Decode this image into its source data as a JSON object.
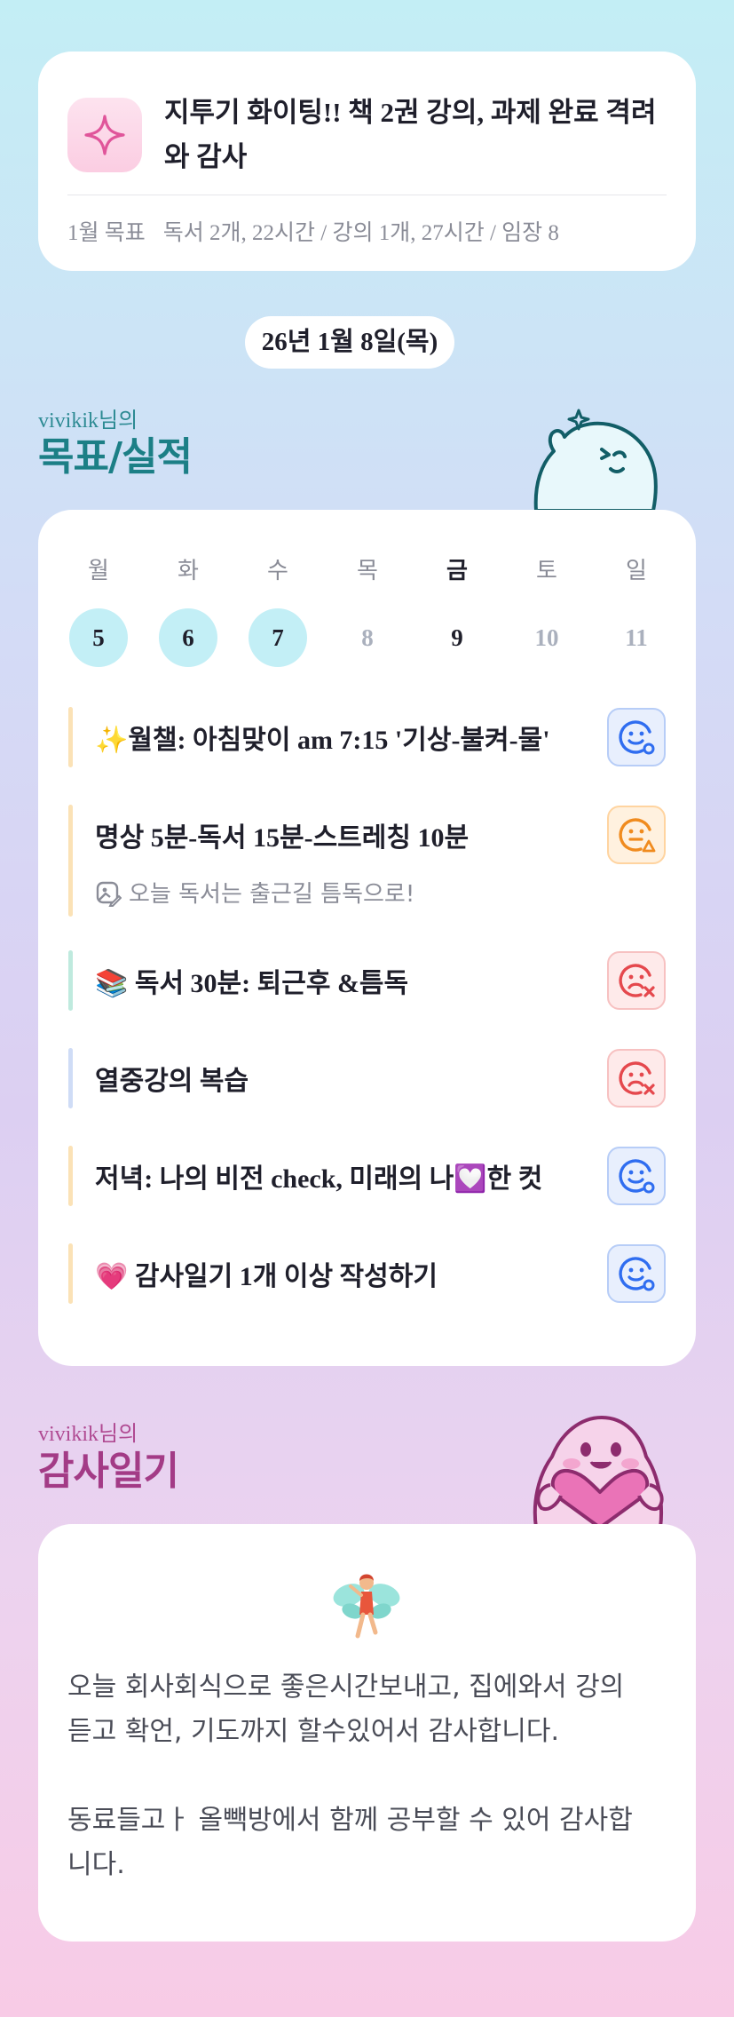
{
  "top_card": {
    "title": "지투기 화이팅!! 책 2권 강의, 과제 완료 격려와 감사",
    "goal_label": "1월 목표",
    "goal_text": "독서 2개, 22시간 / 강의 1개, 27시간 / 임장 8"
  },
  "date_pill": "26년 1월 8일(목)",
  "goals_section": {
    "user": "vivikik님의",
    "title": "목표/실적",
    "weekdays": [
      "월",
      "화",
      "수",
      "목",
      "금",
      "토",
      "일"
    ],
    "dates": [
      "5",
      "6",
      "7",
      "8",
      "9",
      "10",
      "11"
    ],
    "tasks": [
      {
        "text": "✨월챌: 아침맞이 am 7:15 '기상-불켜-물'",
        "status": "good",
        "bar": "#fbe2b6"
      },
      {
        "text": "명상 5분-독서 15분-스트레칭 10분",
        "note": "오늘 독서는 출근길 틈독으로!",
        "status": "warn",
        "bar": "#fbe2b6"
      },
      {
        "text": "📚 독서 30분: 퇴근후 &틈독",
        "status": "bad",
        "bar": "#bfeade"
      },
      {
        "text": "열중강의 복습",
        "status": "bad",
        "bar": "#cfdcf6"
      },
      {
        "text": "저녁: 나의 비전 check, 미래의 나💟한 컷",
        "status": "good",
        "bar": "#fbe2b6"
      },
      {
        "text": "💗 감사일기 1개 이상 작성하기",
        "status": "good",
        "bar": "#fbe2b6"
      }
    ]
  },
  "thanks_section": {
    "user": "vivikik님의",
    "title": "감사일기",
    "paragraph1_line1": "오늘 회사회식으로 좋은시간보내고, 집에와서 강의",
    "paragraph1_line2": "듣고 확언, 기도까지 할수있어서 감사합니다.",
    "paragraph2_line1": "동료들고ㅏ 올빽방에서 함께 공부할 수 있어 감사합",
    "paragraph2_line2": "니다."
  },
  "colors": {
    "teal": "#1c7f86",
    "pink": "#a33b86",
    "blue": "#2f6df0",
    "orange": "#f08b1e",
    "red": "#e5484d"
  }
}
